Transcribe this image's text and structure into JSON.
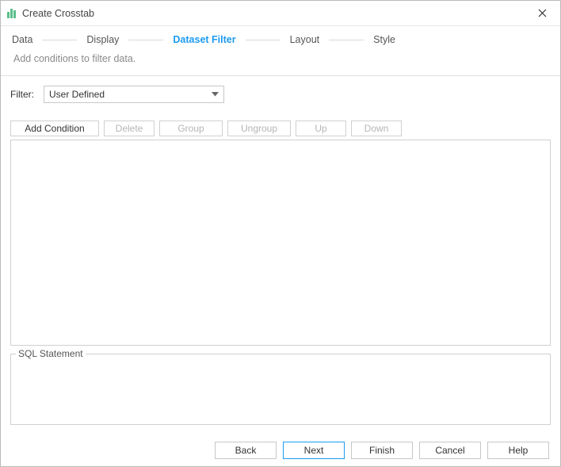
{
  "title": "Create Crosstab",
  "steps": {
    "items": [
      {
        "label": "Data"
      },
      {
        "label": "Display"
      },
      {
        "label": "Dataset Filter"
      },
      {
        "label": "Layout"
      },
      {
        "label": "Style"
      }
    ],
    "active_index": 2
  },
  "subtitle": "Add conditions to filter data.",
  "filter": {
    "label": "Filter:",
    "value": "User Defined"
  },
  "toolbar": {
    "add": "Add Condition",
    "delete": "Delete",
    "group": "Group",
    "ungroup": "Ungroup",
    "up": "Up",
    "down": "Down"
  },
  "sql": {
    "legend": "SQL Statement"
  },
  "footer": {
    "back": "Back",
    "next": "Next",
    "finish": "Finish",
    "cancel": "Cancel",
    "help": "Help"
  }
}
